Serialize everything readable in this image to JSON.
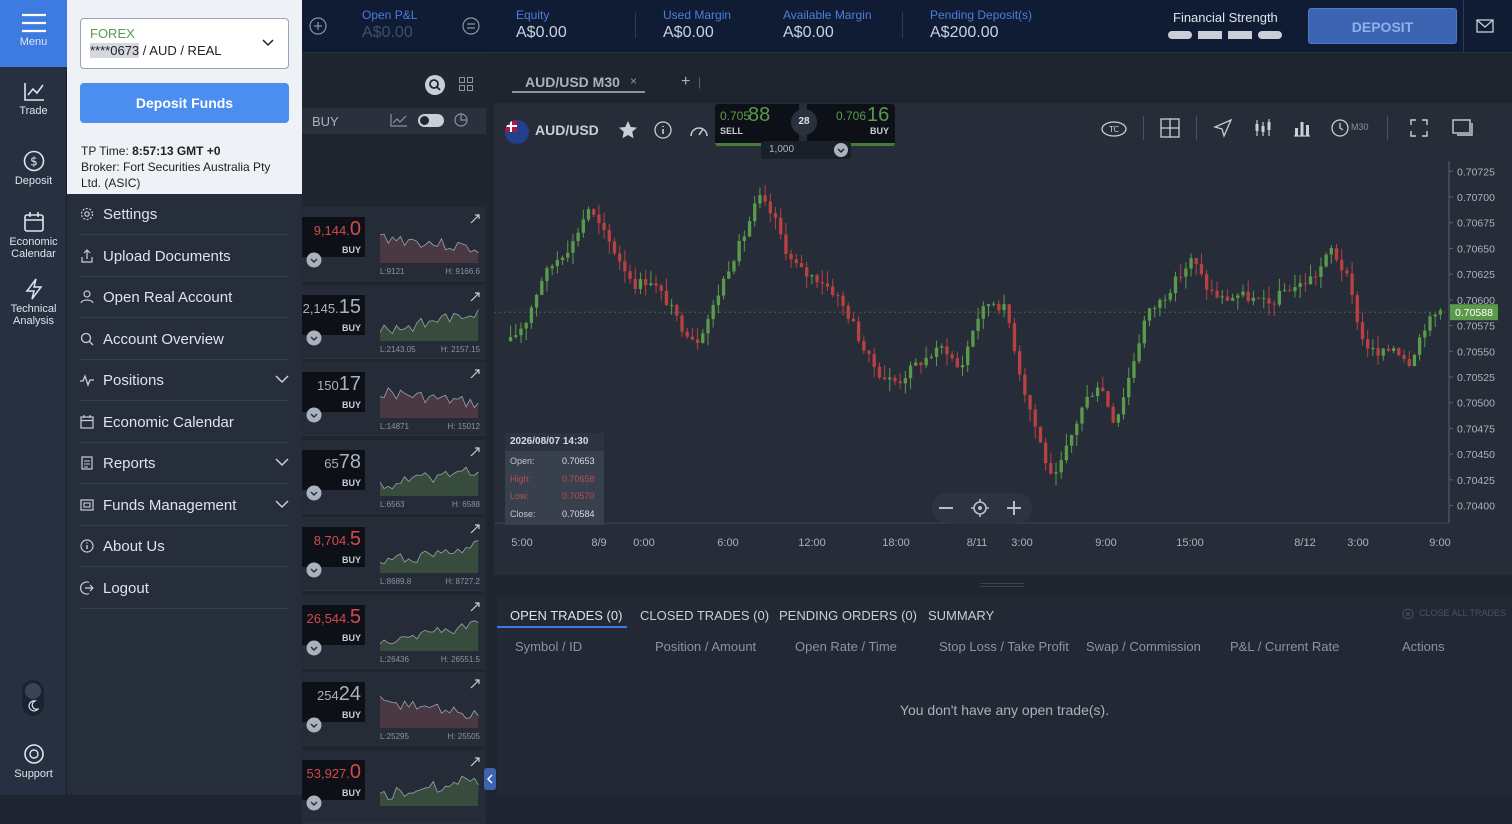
{
  "rail": {
    "items": [
      {
        "label": "Menu",
        "icon": "hamburger-icon"
      },
      {
        "label": "Trade",
        "icon": "chart-line-icon"
      },
      {
        "label": "Deposit",
        "icon": "dollar-circle-icon"
      },
      {
        "label": "Economic Calendar",
        "icon": "calendar-icon"
      },
      {
        "label": "Technical Analysis",
        "icon": "lightning-icon"
      },
      {
        "label": "Support",
        "icon": "support-icon"
      }
    ]
  },
  "topbar": {
    "open_pl_label": "Open P&L",
    "open_pl_value": "A$0.00",
    "equity_label": "Equity",
    "equity_value": "A$0.00",
    "used_margin_label": "Used Margin",
    "used_margin_value": "A$0.00",
    "available_margin_label": "Available Margin",
    "available_margin_value": "A$0.00",
    "pending_label": "Pending Deposit(s)",
    "pending_value": "A$200.00",
    "strength_label": "Financial Strength",
    "deposit_label": "DEPOSIT"
  },
  "menu": {
    "account_type": "FOREX",
    "account_masked": "****0673",
    "account_suffix": " / AUD / REAL",
    "deposit_funds": "Deposit Funds",
    "tp_time_label": "TP Time: ",
    "tp_time_value": "8:57:13 GMT +0",
    "broker": "Broker: Fort Securities Australia Pty Ltd. (ASIC)",
    "items": [
      {
        "label": "Settings",
        "icon": "gear-icon",
        "expandable": false
      },
      {
        "label": "Upload Documents",
        "icon": "upload-icon",
        "expandable": false
      },
      {
        "label": "Open Real Account",
        "icon": "user-icon",
        "expandable": false
      },
      {
        "label": "Account Overview",
        "icon": "magnifier-icon",
        "expandable": false
      },
      {
        "label": "Positions",
        "icon": "pulse-icon",
        "expandable": true
      },
      {
        "label": "Economic Calendar",
        "icon": "calendar-icon",
        "expandable": false
      },
      {
        "label": "Reports",
        "icon": "report-icon",
        "expandable": true
      },
      {
        "label": "Funds Management",
        "icon": "wallet-icon",
        "expandable": true
      },
      {
        "label": "About Us",
        "icon": "info-icon",
        "expandable": false
      },
      {
        "label": "Logout",
        "icon": "logout-icon",
        "expandable": false
      }
    ]
  },
  "watchlist": {
    "header_buy": "BUY",
    "rows": [
      {
        "price_small": "9,144.",
        "price_big": "0",
        "side": "BUY",
        "low": "L:9121",
        "high": "H: 9166.6",
        "color": "#d34a4a",
        "trend": "down"
      },
      {
        "price_small": "2,145.",
        "price_big": "15",
        "side": "BUY",
        "low": "L:2143.05",
        "high": "H: 2157.15",
        "color": "#aab2bd",
        "trend": "up"
      },
      {
        "price_small": "150",
        "price_big": "17",
        "side": "BUY",
        "low": "L:14871",
        "high": "H: 15012",
        "color": "#aab2bd",
        "trend": "down"
      },
      {
        "price_small": "65",
        "price_big": "78",
        "side": "BUY",
        "low": "L:6563",
        "high": "H: 6588",
        "color": "#aab2bd",
        "trend": "up"
      },
      {
        "price_small": "8,704.",
        "price_big": "5",
        "side": "BUY",
        "low": "L:8689.8",
        "high": "H: 8727.2",
        "color": "#d34a4a",
        "trend": "up"
      },
      {
        "price_small": "26,544.",
        "price_big": "5",
        "side": "BUY",
        "low": "L:26436",
        "high": "H: 26551.5",
        "color": "#d34a4a",
        "trend": "up"
      },
      {
        "price_small": "254",
        "price_big": "24",
        "side": "BUY",
        "low": "L:25295",
        "high": "H: 25505",
        "color": "#aab2bd",
        "trend": "down"
      },
      {
        "price_small": "53,927.",
        "price_big": "0",
        "side": "BUY",
        "low": "",
        "high": "",
        "color": "#d34a4a",
        "trend": "up"
      }
    ]
  },
  "chart": {
    "tab_label": "AUD/USD M30",
    "symbol": "AUD/USD",
    "sell_price_small": "0.705",
    "sell_price_big": "88",
    "sell_label": "SELL",
    "spread": "28",
    "buy_price_small": "0.706",
    "buy_price_big": "16",
    "buy_label": "BUY",
    "amount": "1,000",
    "tf_label": "M30",
    "current_price": "0.70588",
    "ohlc": {
      "date": "2026/08/07 14:30",
      "open_label": "Open:",
      "open": "0.70653",
      "high_label": "High:",
      "high": "0.70658",
      "low_label": "Low:",
      "low": "0.70570",
      "close_label": "Close:",
      "close": "0.70584"
    }
  },
  "chart_data": {
    "type": "candlestick",
    "ylim": [
      0.70385,
      0.70735
    ],
    "y_ticks": [
      "0.70725",
      "0.70700",
      "0.70675",
      "0.70650",
      "0.70625",
      "0.70600",
      "0.70575",
      "0.70550",
      "0.70525",
      "0.70500",
      "0.70475",
      "0.70450",
      "0.70425",
      "0.70400"
    ],
    "x_ticks": [
      "5:00",
      "8/9",
      "0:00",
      "6:00",
      "12:00",
      "18:00",
      "8/11",
      "3:00",
      "9:00",
      "15:00",
      "8/12",
      "3:00",
      "9:00"
    ]
  },
  "trades": {
    "tabs": [
      "OPEN TRADES (0)",
      "CLOSED TRADES (0)",
      "PENDING ORDERS (0)",
      "SUMMARY"
    ],
    "close_all": "CLOSE ALL TRADES",
    "columns": [
      "Symbol / ID",
      "Position / Amount",
      "Open Rate / Time",
      "Stop Loss / Take Profit",
      "Swap / Commission",
      "P&L / Current Rate",
      "Actions"
    ],
    "empty_text": "You don't have any open trade(s)."
  },
  "colors": {
    "accent": "#4c8ef0",
    "bull": "#5b9a4b",
    "bear": "#b84040",
    "rail": "#273040"
  }
}
